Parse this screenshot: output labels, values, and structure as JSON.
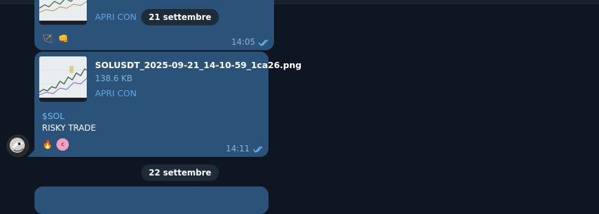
{
  "messages": [
    {
      "open_label": "APRI CON",
      "time": "14:05",
      "reactions": [
        {
          "icon": "bow-arrow-icon",
          "glyph": "🏹"
        },
        {
          "icon": "fist-bump-icon",
          "glyph": "👊"
        }
      ]
    },
    {
      "file_name": "SOLUSDT_2025-09-21_14-10-59_1ca26.png",
      "file_size": "138.6 KB",
      "open_label": "APRI CON",
      "hashtag": "$SOL",
      "text": "RISKY TRADE",
      "time": "14:11",
      "reactions": [
        {
          "icon": "fire-icon",
          "glyph": "🔥"
        },
        {
          "icon": "reaction-badge-icon",
          "glyph": "c"
        }
      ]
    }
  ],
  "date_separators": [
    "21 settembre",
    "22 settembre"
  ],
  "colors": {
    "background": "#0e1621",
    "bubble": "#2b5278",
    "link": "#5fa7e0",
    "hashtag": "#71baf2",
    "date_pill": "#1e2c3a"
  }
}
